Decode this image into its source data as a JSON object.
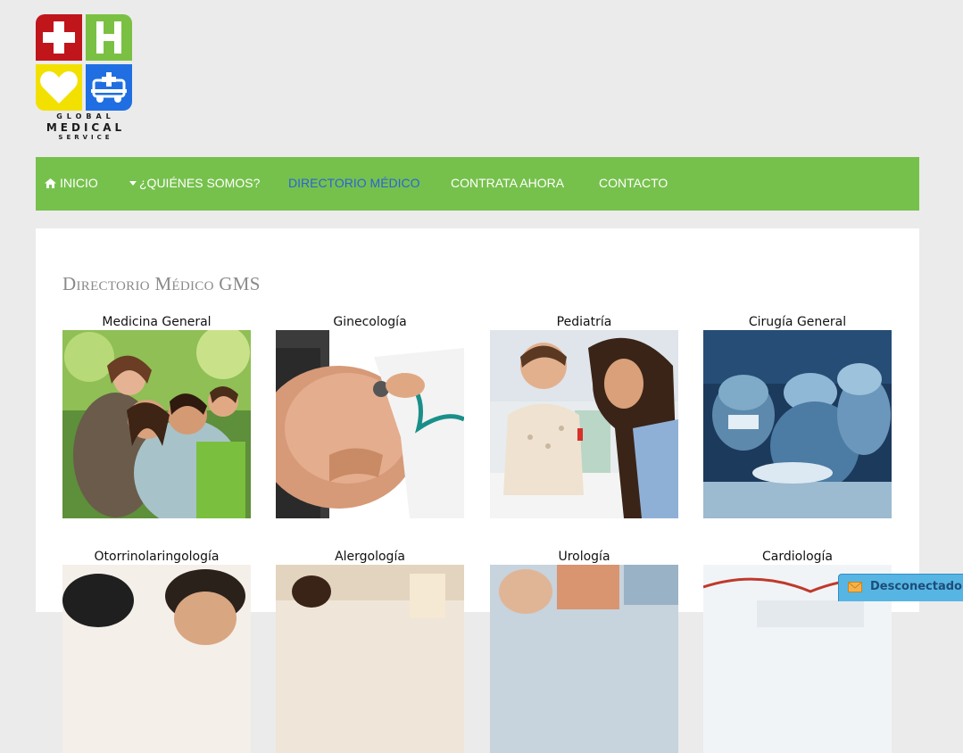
{
  "logo": {
    "line1": "GLOBAL",
    "line2": "MEDICAL",
    "line3": "SERVICE",
    "colors": {
      "red": "#c0151b",
      "green": "#7ac143",
      "yellow": "#f2e100",
      "blue": "#1f6fe3"
    }
  },
  "nav": {
    "background": "#76c14c",
    "active_color": "#2a64d8",
    "items": [
      {
        "label": "INICIO",
        "icon": "home-icon"
      },
      {
        "label": "¿QUIÉNES SOMOS?",
        "icon": "caret-down-icon"
      },
      {
        "label": "DIRECTORIO MÉDICO",
        "active": true
      },
      {
        "label": "CONTRATA AHORA"
      },
      {
        "label": "CONTACTO"
      }
    ]
  },
  "main": {
    "title": "Directorio Médico GMS",
    "cards": [
      {
        "title": "Medicina General",
        "image": "family-photo"
      },
      {
        "title": "Ginecología",
        "image": "pregnant-stethoscope-photo"
      },
      {
        "title": "Pediatría",
        "image": "child-doctor-photo"
      },
      {
        "title": "Cirugía General",
        "image": "surgeons-photo"
      },
      {
        "title": "Otorrinolaringología",
        "image": "ent-photo"
      },
      {
        "title": "Alergología",
        "image": "allergy-photo"
      },
      {
        "title": "Urología",
        "image": "urology-photo"
      },
      {
        "title": "Cardiología",
        "image": "cardiology-photo"
      }
    ]
  },
  "chat": {
    "label": "Desconectado -",
    "icon": "envelope-icon"
  }
}
